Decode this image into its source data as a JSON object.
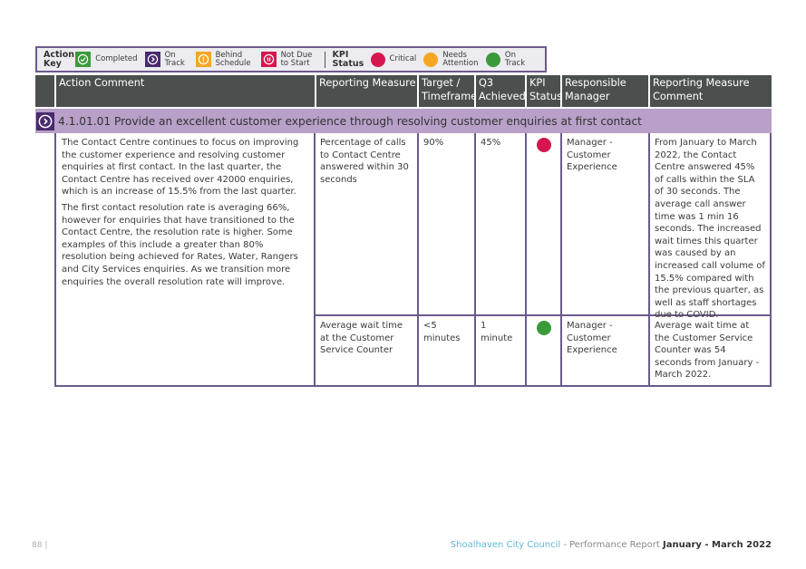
{
  "legend": {
    "action_key_label": "Action Key",
    "action_items": [
      {
        "label": "Completed",
        "icon": "check-circle-icon",
        "color": "#3a9a3a"
      },
      {
        "label": "On Track",
        "icon": "chevron-right-circle-icon",
        "color": "#4a2a6e"
      },
      {
        "label": "Behind Schedule",
        "icon": "exclamation-circle-icon",
        "color": "#f5a623"
      },
      {
        "label": "Not Due to Start",
        "icon": "pause-circle-icon",
        "color": "#d6174f"
      }
    ],
    "kpi_label": "KPI Status",
    "kpi_items": [
      {
        "label": "Critical",
        "color": "#d6174f"
      },
      {
        "label": "Needs Attention",
        "color": "#f5a623"
      },
      {
        "label": "On Track",
        "color": "#3a9a3a"
      }
    ]
  },
  "table": {
    "headers": [
      "Action Comment",
      "Reporting Measure",
      "Target / Timeframe",
      "Q3 Achieved",
      "KPI Status",
      "Responsible Manager",
      "Reporting Measure Comment"
    ],
    "action": {
      "status_icon": "on-track",
      "title": "4.1.01.01 Provide an excellent customer experience through resolving customer enquiries at first contact",
      "comment_paragraphs": [
        "The Contact Centre continues to focus on improving the customer experience and resolving customer enquiries at first contact. In the last quarter, the Contact Centre has received over 42000 enquiries, which is an increase of 15.5% from the last quarter.",
        "The first contact resolution rate is averaging 66%, however for enquiries that have transitioned to the Contact Centre, the resolution rate is higher. Some examples of this include a greater than 80% resolution being achieved for Rates, Water, Rangers and City Services enquiries. As we transition more enquiries the overall resolution rate will improve."
      ],
      "measures": [
        {
          "measure": "Percentage of calls to Contact Centre answered within 30 seconds",
          "target": "90%",
          "achieved": "45%",
          "kpi_status": "Critical",
          "kpi_color": "#d6174f",
          "manager": "Manager - Customer Experience",
          "comment": "From January to March 2022, the Contact Centre answered 45% of calls within the SLA of 30 seconds. The average call answer time was 1 min 16 seconds. The increased wait times this quarter was caused by an increased call volume of 15.5% compared with the previous quarter, as well as staff shortages due to COVID."
        },
        {
          "measure": "Average wait time at the Customer Service Counter",
          "target": "<5 minutes",
          "achieved": "1 minute",
          "kpi_status": "On Track",
          "kpi_color": "#3a9a3a",
          "manager": "Manager - Customer Experience",
          "comment": "Average wait time at the Customer Service Counter was 54 seconds from January - March 2022."
        }
      ]
    }
  },
  "footer": {
    "page_number": "88 |",
    "org": "Shoalhaven City Council",
    "report": " - Performance Report ",
    "period": "January - March 2022"
  }
}
